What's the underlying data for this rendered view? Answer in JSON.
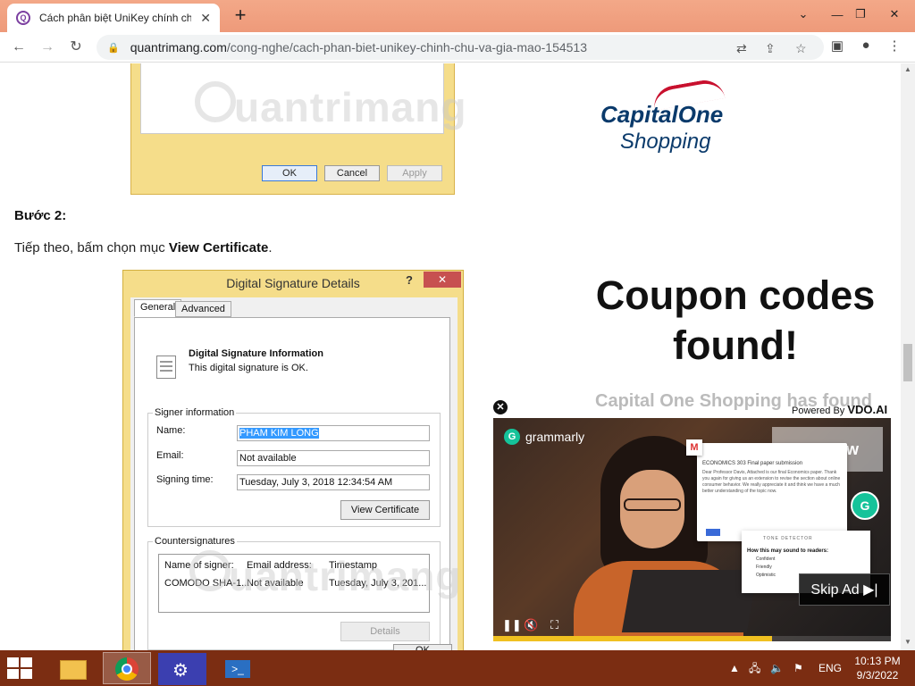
{
  "browser": {
    "tab_title": "Cách phân biệt UniKey chính chủ",
    "tab_favicon": "Q",
    "url_host": "quantrimang.com",
    "url_path": "/cong-nghe/cach-phan-biet-unikey-chinh-chu-va-gia-mao-154513"
  },
  "top_dialog": {
    "ok": "OK",
    "cancel": "Cancel",
    "apply": "Apply"
  },
  "article": {
    "heading": "Bước 2:",
    "para_prefix": "Tiếp theo, bấm chọn mục ",
    "para_bold": "View Certificate",
    "para_suffix": "."
  },
  "dialog": {
    "title": "Digital Signature Details",
    "help": "?",
    "close": "✕",
    "tab_general": "General",
    "tab_advanced": "Advanced",
    "info_title": "Digital Signature Information",
    "info_sub": "This digital signature is OK.",
    "signer_group": "Signer information",
    "name_label": "Name:",
    "name_value": "PHAM KIM LONG",
    "email_label": "Email:",
    "email_value": "Not available",
    "time_label": "Signing time:",
    "time_value": "Tuesday, July 3, 2018 12:34:54 AM",
    "view_cert": "View Certificate",
    "counter_group": "Countersignatures",
    "col_name": "Name of signer:",
    "col_email": "Email address:",
    "col_time": "Timestamp",
    "row_name": "COMODO SHA-1...",
    "row_email": "Not available",
    "row_time": "Tuesday, July 3, 201...",
    "details": "Details",
    "ok": "OK"
  },
  "watermark": "uantrimang",
  "ad": {
    "brand_1": "Capital",
    "brand_2": "One",
    "brand_3": "Shopping",
    "coupon": "Coupon codes found!",
    "faded": "Capital One Shopping has found",
    "powered_prefix": "Powered By ",
    "powered_brand": "VDO.AI",
    "video_brand": "grammarly",
    "try_now": "Try Now",
    "email_subject": "ECONOMICS 303 Final paper submission",
    "email_body": "Dear Professor Davis, Attached is our final Economics paper. Thank you again for giving us an extension to revise the section about online consumer behavior. We really appreciate it and think we have a much better understanding of the topic now.",
    "tone_header": "TONE DETECTOR",
    "tone_question": "How this may sound to readers:",
    "tone_1": "Confident",
    "tone_2": "Friendly",
    "tone_3": "Optimistic",
    "skip": "Skip Ad",
    "progress": 0.7
  },
  "taskbar": {
    "lang": "ENG",
    "time": "10:13 PM",
    "date": "9/3/2022"
  }
}
